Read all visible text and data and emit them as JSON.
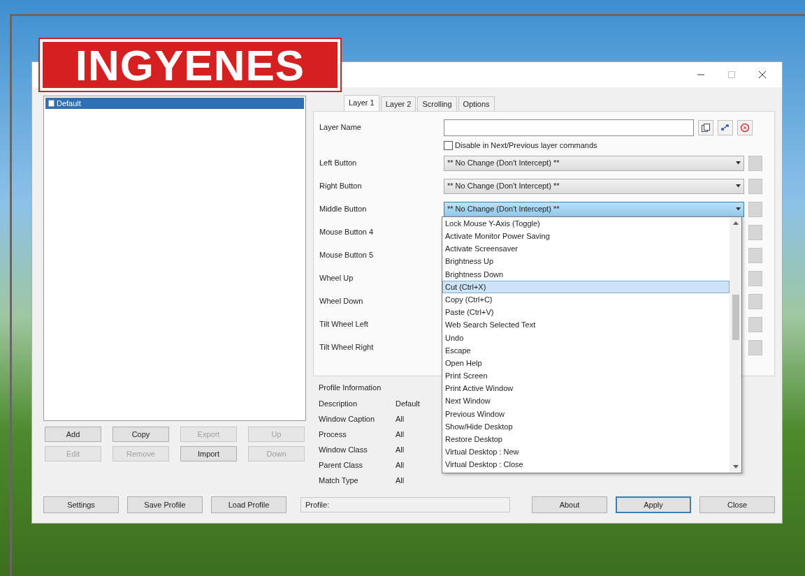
{
  "banner": {
    "text": "INGYENES"
  },
  "window": {
    "controls": [
      {
        "kind": "minimize",
        "disabled": false
      },
      {
        "kind": "maximize",
        "disabled": true
      },
      {
        "kind": "close",
        "disabled": false
      }
    ]
  },
  "profiles": {
    "items": [
      {
        "label": "Default",
        "selected": true
      }
    ],
    "buttons": [
      {
        "label": "Add",
        "disabled": false
      },
      {
        "label": "Copy",
        "disabled": false
      },
      {
        "label": "Export",
        "disabled": true
      },
      {
        "label": "Up",
        "disabled": true
      },
      {
        "label": "Edit",
        "disabled": true
      },
      {
        "label": "Remove",
        "disabled": true
      },
      {
        "label": "Import",
        "disabled": false
      },
      {
        "label": "Down",
        "disabled": true
      }
    ]
  },
  "tabs": [
    {
      "label": "Layer 1",
      "selected": true
    },
    {
      "label": "Layer 2",
      "selected": false
    },
    {
      "label": "Scrolling",
      "selected": false
    },
    {
      "label": "Options",
      "selected": false
    }
  ],
  "layer_name": {
    "label": "Layer Name"
  },
  "checkbox": {
    "label": "Disable in Next/Previous layer commands",
    "checked": false
  },
  "mappings": [
    {
      "label": "Left Button",
      "value": "** No Change (Don't Intercept) **",
      "focused": false
    },
    {
      "label": "Right Button",
      "value": "** No Change (Don't Intercept) **",
      "focused": false
    },
    {
      "label": "Middle Button",
      "value": "** No Change (Don't Intercept) **",
      "focused": true
    },
    {
      "label": "Mouse Button 4"
    },
    {
      "label": "Mouse Button 5"
    },
    {
      "label": "Wheel Up"
    },
    {
      "label": "Wheel Down"
    },
    {
      "label": "Tilt Wheel Left"
    },
    {
      "label": "Tilt Wheel Right"
    }
  ],
  "dropdown": {
    "items": [
      {
        "label": "Lock Mouse Y-Axis (Toggle)",
        "selected": false
      },
      {
        "label": "Activate Monitor Power Saving",
        "selected": false
      },
      {
        "label": "Activate Screensaver",
        "selected": false
      },
      {
        "label": "Brightness Up",
        "selected": false
      },
      {
        "label": "Brightness Down",
        "selected": false
      },
      {
        "label": "Cut (Ctrl+X)",
        "selected": true
      },
      {
        "label": "Copy (Ctrl+C)",
        "selected": false
      },
      {
        "label": "Paste (Ctrl+V)",
        "selected": false
      },
      {
        "label": "Web Search Selected Text",
        "selected": false
      },
      {
        "label": "Undo",
        "selected": false
      },
      {
        "label": "Escape",
        "selected": false
      },
      {
        "label": "Open Help",
        "selected": false
      },
      {
        "label": "Print Screen",
        "selected": false
      },
      {
        "label": "Print Active Window",
        "selected": false
      },
      {
        "label": "Next Window",
        "selected": false
      },
      {
        "label": "Previous Window",
        "selected": false
      },
      {
        "label": "Show/Hide Desktop",
        "selected": false
      },
      {
        "label": "Restore Desktop",
        "selected": false
      },
      {
        "label": "Virtual Desktop : New",
        "selected": false
      },
      {
        "label": "Virtual Desktop : Close",
        "selected": false
      }
    ]
  },
  "profile_info": {
    "title": "Profile Information",
    "rows": [
      {
        "label": "Description",
        "value": "Default"
      },
      {
        "label": "Window Caption",
        "value": "All"
      },
      {
        "label": "Process",
        "value": "All"
      },
      {
        "label": "Window Class",
        "value": "All"
      },
      {
        "label": "Parent Class",
        "value": "All"
      },
      {
        "label": "Match Type",
        "value": "All"
      }
    ]
  },
  "footer": {
    "left_buttons": [
      {
        "label": "Settings",
        "default": false
      },
      {
        "label": "Save Profile",
        "default": false
      },
      {
        "label": "Load Profile",
        "default": false
      }
    ],
    "status": "Profile:",
    "right_buttons": [
      {
        "label": "About",
        "default": false
      },
      {
        "label": "Apply",
        "default": true
      },
      {
        "label": "Close",
        "default": false
      }
    ]
  }
}
